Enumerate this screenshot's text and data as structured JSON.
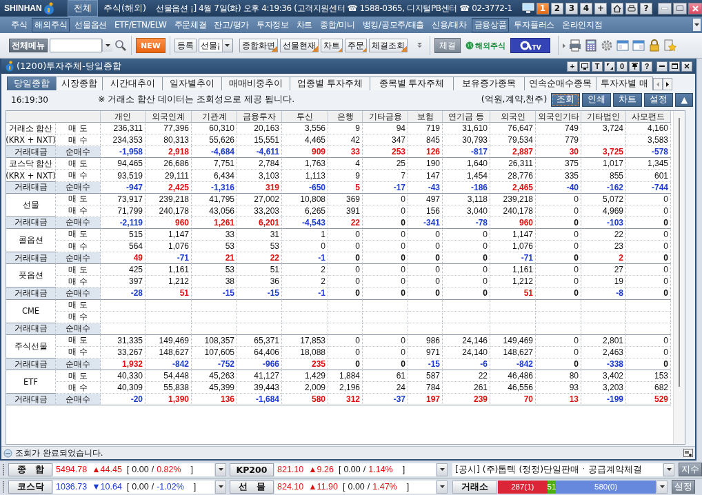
{
  "title_bar": {
    "logo": "SHINHAN",
    "tabs": [
      {
        "label": "전체",
        "selected": true
      },
      {
        "label": "주식(해외)",
        "selected": false
      }
    ],
    "ticker": "선물옵션 ¡] 4월 7일(화) 오후 4:19:36 (고객지원센터 ☎ 1588-0365, 디지털PB센터 ☎ 02-3772-1",
    "screens": [
      {
        "label": "1",
        "selected": true
      },
      {
        "label": "2",
        "selected": false
      },
      {
        "label": "3",
        "selected": false
      },
      {
        "label": "4",
        "selected": false
      },
      {
        "label": "+",
        "selected": false
      }
    ],
    "help": "?"
  },
  "menu": [
    {
      "label": "주식",
      "selected": false
    },
    {
      "label": "해외주식",
      "selected": true
    },
    {
      "label": "선물옵션",
      "selected": false
    },
    {
      "label": "ETF/ETN/ELW",
      "selected": false
    },
    {
      "label": "주문체결",
      "selected": false
    },
    {
      "label": "잔고/평가",
      "selected": false
    },
    {
      "label": "투자정보",
      "selected": false
    },
    {
      "label": "차트",
      "selected": false
    },
    {
      "label": "종합/미니",
      "selected": false
    },
    {
      "label": "뱅킹/공모주/대출",
      "selected": false
    },
    {
      "label": "신용/대차",
      "selected": false
    },
    {
      "label": "금융상품",
      "selected": true
    },
    {
      "label": "투자플러스",
      "selected": false
    },
    {
      "label": "온라인지점",
      "selected": false
    }
  ],
  "toolbar": {
    "all_menu": "전체메뉴",
    "new_badge": "NEW",
    "register": "등록",
    "combo_value": "선물¡",
    "buttons": [
      "종합화면",
      "선물현재",
      "차트",
      "주문",
      "체결조회"
    ],
    "fill_button": "체결",
    "overseas_link": "해외주식",
    "tv_button": "TV"
  },
  "window": {
    "title": "(1200)투자주체-당일종합",
    "controls": [
      {
        "kind": "text",
        "label": "+"
      },
      {
        "kind": "monitor"
      },
      {
        "kind": "text",
        "label": "T"
      },
      {
        "kind": "resize"
      },
      {
        "kind": "text",
        "label": "0"
      },
      {
        "kind": "pin"
      },
      {
        "kind": "text",
        "label": "?"
      }
    ]
  },
  "tabs": [
    {
      "label": "당일종합",
      "selected": true
    },
    {
      "label": "시장종합",
      "selected": false
    },
    {
      "label": "시간대추이",
      "selected": false
    },
    {
      "label": "일자별추이",
      "selected": false
    },
    {
      "label": "매매비중추이",
      "selected": false
    },
    {
      "label": "업종별 투자주체",
      "selected": false
    },
    {
      "label": "종목별 투자주체",
      "selected": false
    },
    {
      "label": "보유증가종목",
      "selected": false
    },
    {
      "label": "연속순매수종목",
      "selected": false
    },
    {
      "label": "투자자별 매",
      "selected": false
    }
  ],
  "info": {
    "time": "16:19:30",
    "notice": "※ 거래소 합산 데이터는 조회성으로 제공 됩니다.",
    "units": "(억원,계약,천주)",
    "buttons": [
      {
        "label": "조회",
        "focused": true
      },
      {
        "label": "인쇄",
        "focused": false
      },
      {
        "label": "차트",
        "focused": false
      },
      {
        "label": "설정",
        "focused": false
      },
      {
        "label": "▲",
        "focused": false
      }
    ]
  },
  "table": {
    "columns": [
      "개인",
      "외국인계",
      "기관계",
      "금융투자",
      "투신",
      "은행",
      "기타금융",
      "보험",
      "연기금 등",
      "외국인",
      "외국인기타",
      "기타법인",
      "사모펀드"
    ],
    "groups": [
      {
        "title": "거래소 합산",
        "subtitle": "(KRX + NXT)",
        "footer": "거래대금",
        "rows": [
          {
            "label": "매 도",
            "values": [
              "236,311",
              "77,396",
              "60,310",
              "20,163",
              "3,556",
              "9",
              "94",
              "719",
              "31,610",
              "76,647",
              "749",
              "3,724",
              "4,160"
            ]
          },
          {
            "label": "매 수",
            "values": [
              "234,353",
              "80,313",
              "55,626",
              "15,551",
              "4,465",
              "42",
              "347",
              "845",
              "30,793",
              "79,534",
              "779"
            ],
            "trailing_values": [
              "3,583"
            ]
          },
          {
            "label": "순매수",
            "values": [
              "-1,958",
              "2,918",
              "-4,684",
              "-4,611",
              "909",
              "33",
              "253",
              "126",
              "-817",
              "2,887",
              "30",
              "3,725",
              "-578"
            ]
          }
        ]
      },
      {
        "title": "코스닥 합산",
        "subtitle": "(KRX + NXT)",
        "footer": "거래대금",
        "rows": [
          {
            "label": "매 도",
            "values": [
              "94,465",
              "26,686",
              "7,751",
              "2,784",
              "1,763",
              "4",
              "25",
              "190",
              "1,640",
              "26,311",
              "375",
              "1,017",
              "1,345"
            ]
          },
          {
            "label": "매 수",
            "values": [
              "93,519",
              "29,111",
              "6,434",
              "3,103",
              "1,113",
              "9",
              "7",
              "147",
              "1,454",
              "28,776",
              "335",
              "855",
              "601"
            ]
          },
          {
            "label": "순매수",
            "values": [
              "-947",
              "2,425",
              "-1,316",
              "319",
              "-650",
              "5",
              "-17",
              "-43",
              "-186",
              "2,465",
              "-40",
              "-162",
              "-744"
            ]
          }
        ]
      },
      {
        "title": "선물",
        "footer": "거래대금",
        "rows": [
          {
            "label": "매 도",
            "values": [
              "73,917",
              "239,218",
              "41,795",
              "27,002",
              "10,808",
              "369",
              "0",
              "497",
              "3,118",
              "239,218",
              "0",
              "5,072",
              "0"
            ]
          },
          {
            "label": "매 수",
            "values": [
              "71,799",
              "240,178",
              "43,056",
              "33,203",
              "6,265",
              "391",
              "0",
              "156",
              "3,040",
              "240,178",
              "0",
              "4,969",
              "0"
            ]
          },
          {
            "label": "순매수",
            "values": [
              "-2,119",
              "960",
              "1,261",
              "6,201",
              "-4,543",
              "22",
              "0",
              "-341",
              "-78",
              "960",
              "0",
              "-103",
              "0"
            ]
          }
        ]
      },
      {
        "title": "콜옵션",
        "footer": "거래대금",
        "rows": [
          {
            "label": "매 도",
            "values": [
              "515",
              "1,147",
              "33",
              "31",
              "1",
              "0",
              "0",
              "0",
              "0",
              "1,147",
              "0",
              "22",
              "0"
            ]
          },
          {
            "label": "매 수",
            "values": [
              "564",
              "1,076",
              "53",
              "53",
              "0",
              "0",
              "0",
              "0",
              "0",
              "1,076",
              "0",
              "23",
              "0"
            ]
          },
          {
            "label": "순매수",
            "values": [
              "49",
              "-71",
              "21",
              "22",
              "-1",
              "0",
              "0",
              "0",
              "0",
              "-71",
              "0",
              "2",
              "0"
            ]
          }
        ]
      },
      {
        "title": "풋옵션",
        "footer": "거래대금",
        "rows": [
          {
            "label": "매 도",
            "values": [
              "425",
              "1,161",
              "53",
              "51",
              "2",
              "0",
              "0",
              "0",
              "0",
              "1,161",
              "0",
              "27",
              "0"
            ]
          },
          {
            "label": "매 수",
            "values": [
              "397",
              "1,212",
              "38",
              "36",
              "2",
              "0",
              "0",
              "0",
              "0",
              "1,212",
              "0",
              "19",
              "0"
            ]
          },
          {
            "label": "순매수",
            "values": [
              "-28",
              "51",
              "-15",
              "-15",
              "-1",
              "0",
              "0",
              "0",
              "0",
              "51",
              "0",
              "-8",
              "0"
            ]
          }
        ]
      },
      {
        "title": "CME",
        "footer": "거래대금",
        "rows": [
          {
            "label": "매 도"
          },
          {
            "label": "매 수"
          },
          {
            "label": "순매수"
          }
        ]
      },
      {
        "title": "주식선물",
        "footer": "거래대금",
        "rows": [
          {
            "label": "매 도",
            "values": [
              "31,335",
              "149,469",
              "108,357",
              "65,371",
              "17,853",
              "0",
              "0",
              "986",
              "24,146",
              "149,469",
              "0",
              "2,801",
              "0"
            ]
          },
          {
            "label": "매 수",
            "values": [
              "33,267",
              "148,627",
              "107,605",
              "64,406",
              "18,088",
              "0",
              "0",
              "971",
              "24,140",
              "148,627",
              "0",
              "2,463",
              "0"
            ]
          },
          {
            "label": "순매수",
            "values": [
              "1,932",
              "-842",
              "-752",
              "-966",
              "235",
              "0",
              "0",
              "-15",
              "-6",
              "-842",
              "0",
              "-338",
              "0"
            ]
          }
        ]
      },
      {
        "title": "ETF",
        "footer": "거래대금",
        "rows": [
          {
            "label": "매 도",
            "values": [
              "40,330",
              "54,448",
              "45,263",
              "41,127",
              "1,429",
              "1,884",
              "61",
              "587",
              "22",
              "46,486",
              "80",
              "3,402",
              "153"
            ]
          },
          {
            "label": "매 수",
            "values": [
              "40,309",
              "55,838",
              "45,399",
              "39,443",
              "2,009",
              "2,196",
              "24",
              "784",
              "261",
              "46,556",
              "93",
              "3,203",
              "682"
            ]
          },
          {
            "label": "순매수",
            "values": [
              "-20",
              "1,390",
              "136",
              "-1,684",
              "580",
              "312",
              "-37",
              "197",
              "239",
              "70",
              "13",
              "-199",
              "529"
            ]
          }
        ]
      }
    ]
  },
  "status_bar": {
    "message": "조회가 완료되었습니다."
  },
  "ticker_rows": [
    {
      "indices": [
        {
          "name": "종　합",
          "value": "5494.78",
          "change": "▲44.45",
          "rising": true,
          "open": "[",
          "base": "0.00",
          "slash": "/",
          "rate": "0.82%",
          "close": "]"
        },
        {
          "name": "KP200",
          "value": "821.10",
          "change": "▲9.26",
          "rising": true,
          "open": "[",
          "base": "0.00",
          "slash": "/",
          "rate": "1.14%",
          "close": "]"
        }
      ],
      "extra": {
        "kind": "news",
        "text": "[공시] (주)톱텍 (정정)단일판매ㆍ공급계약체결",
        "button": "지수"
      }
    },
    {
      "indices": [
        {
          "name": "코스닥",
          "value": "1036.73",
          "change": "▼10.64",
          "rising": false,
          "open": "[",
          "base": "0.00",
          "slash": "/",
          "rate": "-1.02%",
          "close": "]"
        },
        {
          "name": "선　물",
          "value": "824.10",
          "change": "▲11.90",
          "rising": true,
          "open": "[",
          "base": "0.00",
          "slash": "/",
          "rate": "1.47%",
          "close": "]"
        }
      ],
      "extra": {
        "kind": "breadth",
        "label": "거래소",
        "segments": [
          {
            "text": "287(1)",
            "color": "#dc2638"
          },
          {
            "text": "51",
            "color": "#4caf0a"
          },
          {
            "text": "580(0)",
            "color": "#6688dd"
          }
        ],
        "button": "설정"
      }
    }
  ]
}
